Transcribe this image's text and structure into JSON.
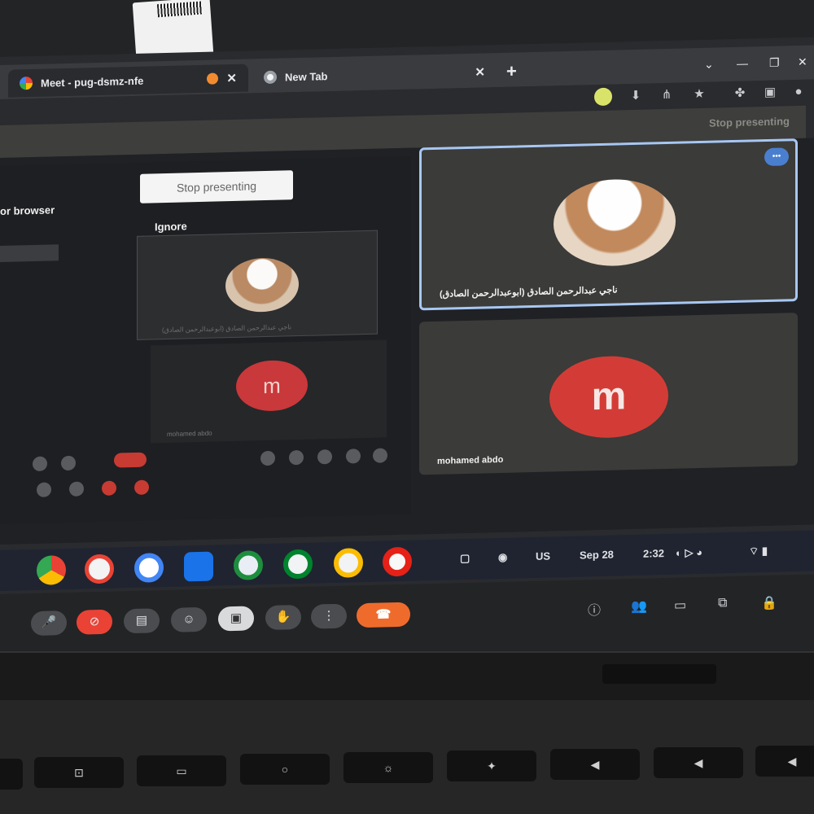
{
  "browser": {
    "tabs": [
      {
        "title": "Meet - pug-dsmz-nfe",
        "favicon": "google-meet-icon",
        "active": true
      },
      {
        "title": "New Tab",
        "favicon": "chrome-icon",
        "active": false
      }
    ],
    "new_tab_symbol": "+",
    "close_symbol": "✕"
  },
  "presenting_bar": {
    "stop_label": "Stop presenting"
  },
  "shared_screen": {
    "side_title": "or browser",
    "stop_button": "Stop presenting",
    "ignore_label": "Ignore",
    "mini_avatar_letter": "m"
  },
  "participants": [
    {
      "name": "ناجي عبدالرحمن الصادق (ابوعبدالرحمن الصادق)",
      "avatar": "photo",
      "speaking": true
    },
    {
      "name": "mohamed abdo",
      "avatar_letter": "m",
      "avatar_color": "#d33c36"
    }
  ],
  "meet_controls": [
    {
      "name": "mic-button",
      "icon": "mic-icon"
    },
    {
      "name": "camera-off-button",
      "icon": "video-off-icon"
    },
    {
      "name": "captions-button",
      "icon": "captions-icon"
    },
    {
      "name": "emoji-button",
      "icon": "emoji-icon"
    },
    {
      "name": "present-button",
      "icon": "present-icon"
    },
    {
      "name": "raise-hand-button",
      "icon": "hand-icon"
    },
    {
      "name": "more-options-button",
      "icon": "more-vert-icon"
    },
    {
      "name": "leave-call-button",
      "icon": "call-end-icon"
    }
  ],
  "shelf": {
    "apps": [
      "chrome",
      "gmail",
      "calendar",
      "files",
      "chat",
      "meet",
      "play-store",
      "youtube"
    ],
    "locale": "US",
    "date": "Sep 28",
    "time": "2:32"
  },
  "colors": {
    "speaker_border": "#a7c7f3",
    "end_call": "#ef6b2c",
    "avatar_red": "#d33c36"
  }
}
